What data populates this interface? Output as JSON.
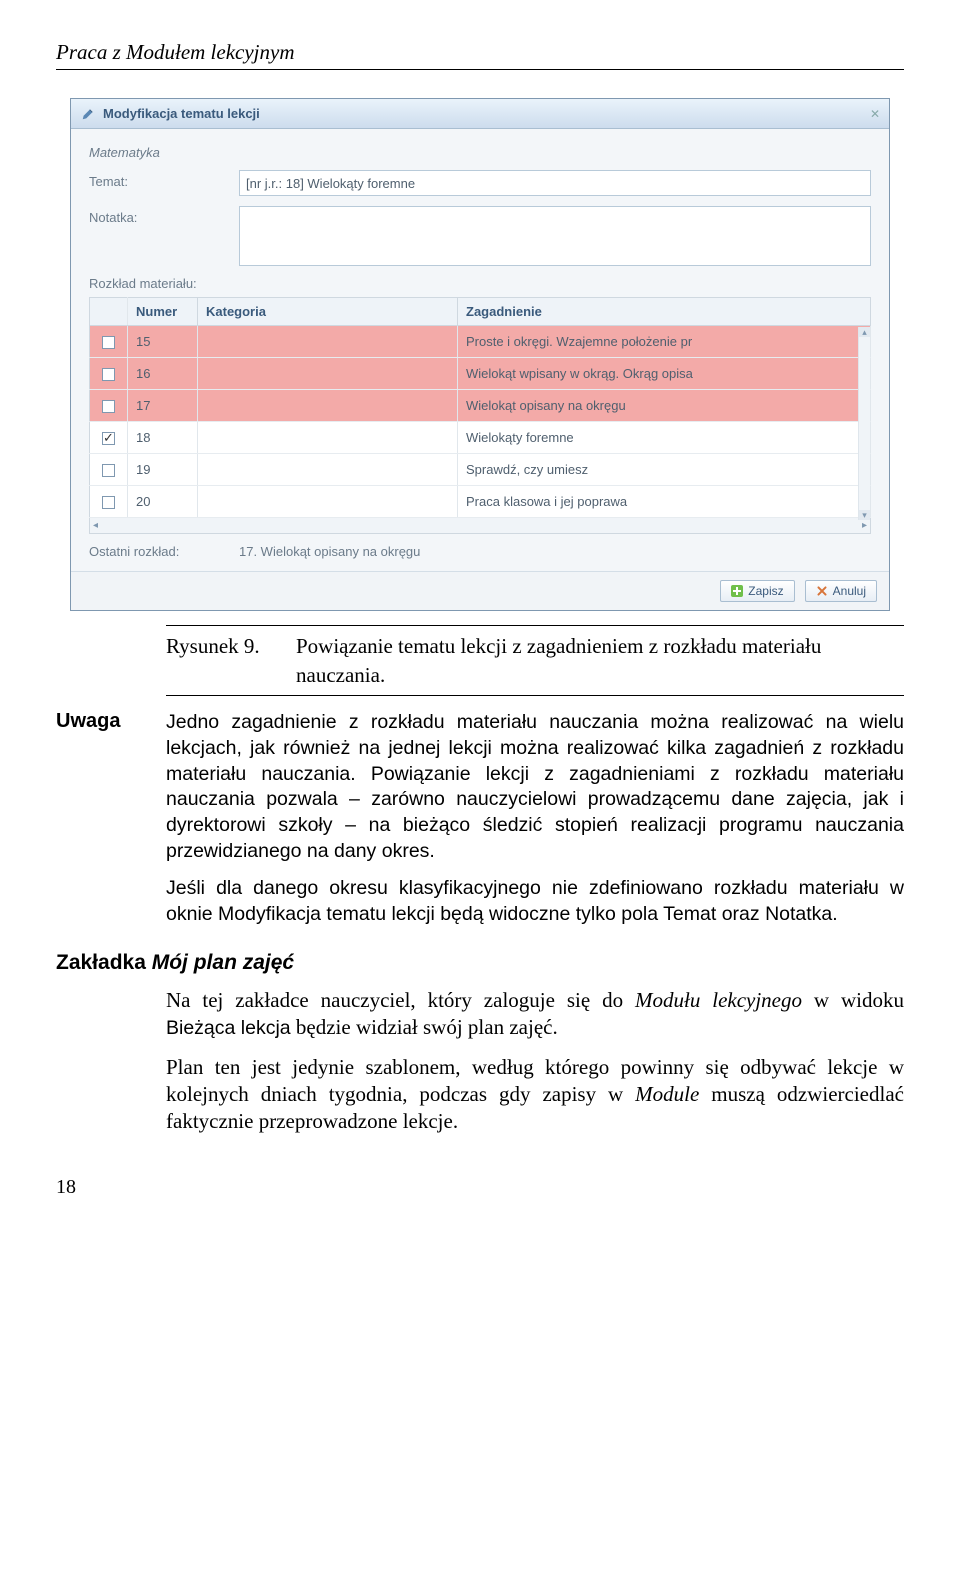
{
  "running_head": "Praca z Modułem lekcyjnym",
  "dialog": {
    "title": "Modyfikacja tematu lekcji",
    "subject": "Matematyka",
    "labels": {
      "temat": "Temat:",
      "notatka": "Notatka:",
      "rozklad": "Rozkład materiału:",
      "ostatni": "Ostatni rozkład:"
    },
    "temat_value": "[nr j.r.: 18] Wielokąty foremne",
    "notatka_value": "",
    "columns": {
      "numer": "Numer",
      "kategoria": "Kategoria",
      "zagadnienie": "Zagadnienie"
    },
    "rows": [
      {
        "checked": false,
        "hl": true,
        "numer": "15",
        "kategoria": "",
        "zagadnienie": "Proste i okręgi. Wzajemne położenie pr"
      },
      {
        "checked": false,
        "hl": true,
        "numer": "16",
        "kategoria": "",
        "zagadnienie": "Wielokąt wpisany w okrąg. Okrąg opisa"
      },
      {
        "checked": false,
        "hl": true,
        "numer": "17",
        "kategoria": "",
        "zagadnienie": "Wielokąt opisany na okręgu"
      },
      {
        "checked": true,
        "hl": false,
        "numer": "18",
        "kategoria": "",
        "zagadnienie": "Wielokąty foremne"
      },
      {
        "checked": false,
        "hl": false,
        "numer": "19",
        "kategoria": "",
        "zagadnienie": "Sprawdź, czy umiesz"
      },
      {
        "checked": false,
        "hl": false,
        "numer": "20",
        "kategoria": "",
        "zagadnienie": "Praca klasowa i jej poprawa"
      }
    ],
    "ostatni_value": "17. Wielokąt opisany na okręgu",
    "buttons": {
      "save": "Zapisz",
      "cancel": "Anuluj"
    }
  },
  "caption": {
    "head": "Rysunek 9.",
    "text": "Powiązanie tematu lekcji z zagadnieniem z rozkładu materiału nauczania."
  },
  "uwaga": {
    "label": "Uwaga",
    "text": "Jedno zagadnienie z rozkładu materiału nauczania można realizować na wielu lekcjach, jak również na jednej lekcji można realizować kilka zagadnień z rozkładu materiału nauczania. Powiązanie lekcji z zagadnieniami z rozkładu materiału nauczania pozwala – zarówno nauczycielowi prowadzącemu dane zajęcia, jak i dyrektorowi szkoły – na bieżąco śledzić stopień realizacji programu nauczania przewidzianego na dany okres."
  },
  "uwaga_para2": {
    "pre": "Jeśli dla danego okresu klasyfikacyjnego nie zdefiniowano rozkładu materiału w oknie ",
    "sans1": "Modyfikacja tematu lekcji",
    "mid": " będą widoczne tylko pola ",
    "sans2": "Temat",
    "and": " oraz ",
    "sans3": "Notatka",
    "end": "."
  },
  "section": {
    "prefix": "Zakładka ",
    "name": "Mój plan zajęć"
  },
  "p1": {
    "a": "Na tej zakładce nauczyciel, który zaloguje się do ",
    "b": "Modułu lekcyjnego",
    "c": " w widoku ",
    "d": "Bieżąca lekcja",
    "e": " będzie widział swój plan zajęć."
  },
  "p2": {
    "a": "Plan ten jest jedynie szablonem, według którego powinny się odbywać lekcje w kolejnych dniach tygodnia, podczas gdy zapisy w ",
    "b": "Module",
    "c": " muszą odzwierciedlać faktycznie przeprowadzone lekcje."
  },
  "page_number": "18"
}
